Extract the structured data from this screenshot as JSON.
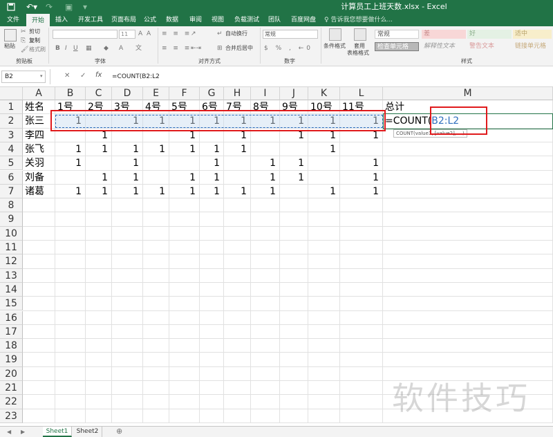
{
  "titlebar": {
    "title": "计算员工上班天数.xlsx - Excel",
    "save_icon": "save-icon",
    "undo_icon": "undo-icon",
    "redo_icon": "redo-icon"
  },
  "ribbon_tabs": [
    "文件",
    "开始",
    "插入",
    "开发工具",
    "页面布局",
    "公式",
    "数据",
    "审阅",
    "视图",
    "负载测试",
    "团队",
    "百度网盘"
  ],
  "active_tab": "开始",
  "tell_me": "告诉我您想要做什么...",
  "ribbon": {
    "paste": "粘贴",
    "cut": "剪切",
    "copy": "复制",
    "format_painter": "格式刷",
    "clipboard_label": "剪贴板",
    "font_size": "11",
    "font_label": "字体",
    "wrap_text": "自动换行",
    "merge_center": "合并后居中",
    "alignment_label": "对齐方式",
    "number_format": "常规",
    "number_label": "数字",
    "conditional_format": "条件格式",
    "table_format": "套用\n表格格式",
    "styles": {
      "normal": "常规",
      "bad": "差",
      "good": "好",
      "neutral": "适中",
      "check_cell": "检查单元格",
      "explanatory": "解释性文本",
      "warning": "警告文本",
      "linked": "链接单元格"
    },
    "styles_label": "样式"
  },
  "formula_bar": {
    "name_box": "B2",
    "formula": "=COUNT(B2:L2",
    "cancel_label": "✕",
    "enter_label": "✓",
    "fx_label": "fx"
  },
  "columns": [
    "A",
    "B",
    "C",
    "D",
    "E",
    "F",
    "G",
    "H",
    "I",
    "J",
    "K",
    "L",
    "M"
  ],
  "rows": [
    "1",
    "2",
    "3",
    "4",
    "5",
    "6",
    "7",
    "8",
    "9",
    "10",
    "11",
    "12",
    "13",
    "14",
    "15",
    "16",
    "17",
    "18",
    "19",
    "20",
    "21",
    "22",
    "23"
  ],
  "header_row": [
    "姓名",
    "1号",
    "2号",
    "3号",
    "4号",
    "5号",
    "6号",
    "7号",
    "8号",
    "9号",
    "10号",
    "11号",
    "总计"
  ],
  "data_rows": [
    {
      "name": "张三",
      "values": [
        "1",
        "",
        "1",
        "1",
        "1",
        "1",
        "1",
        "1",
        "1",
        "1",
        "1"
      ],
      "total": "=COUNT("
    },
    {
      "name": "李四",
      "values": [
        "",
        "1",
        "",
        "",
        "1",
        "",
        "1",
        "",
        "1",
        "1",
        "1"
      ],
      "total": ""
    },
    {
      "name": "张飞",
      "values": [
        "1",
        "1",
        "1",
        "1",
        "1",
        "1",
        "1",
        "",
        "",
        "1",
        ""
      ],
      "total": ""
    },
    {
      "name": "关羽",
      "values": [
        "1",
        "",
        "1",
        "",
        "",
        "1",
        "",
        "1",
        "1",
        "",
        "1"
      ],
      "total": ""
    },
    {
      "name": "刘备",
      "values": [
        "",
        "1",
        "1",
        "",
        "1",
        "1",
        "",
        "1",
        "1",
        "",
        "1"
      ],
      "total": ""
    },
    {
      "name": "诸葛",
      "values": [
        "1",
        "1",
        "1",
        "1",
        "1",
        "1",
        "1",
        "1",
        "",
        "1",
        "1"
      ],
      "total": ""
    }
  ],
  "formula_ref": "B2:L2",
  "formula_tooltip": "COUNT(value1, [value2], ...)",
  "sheets": [
    "Sheet1",
    "Sheet2"
  ],
  "active_sheet": "Sheet1",
  "add_sheet_icon": "plus-circle-icon",
  "watermark": "软件技巧",
  "colors": {
    "excel_green": "#217346",
    "annotation_red": "#e0191b",
    "selection_blue": "#2f6ebd"
  }
}
